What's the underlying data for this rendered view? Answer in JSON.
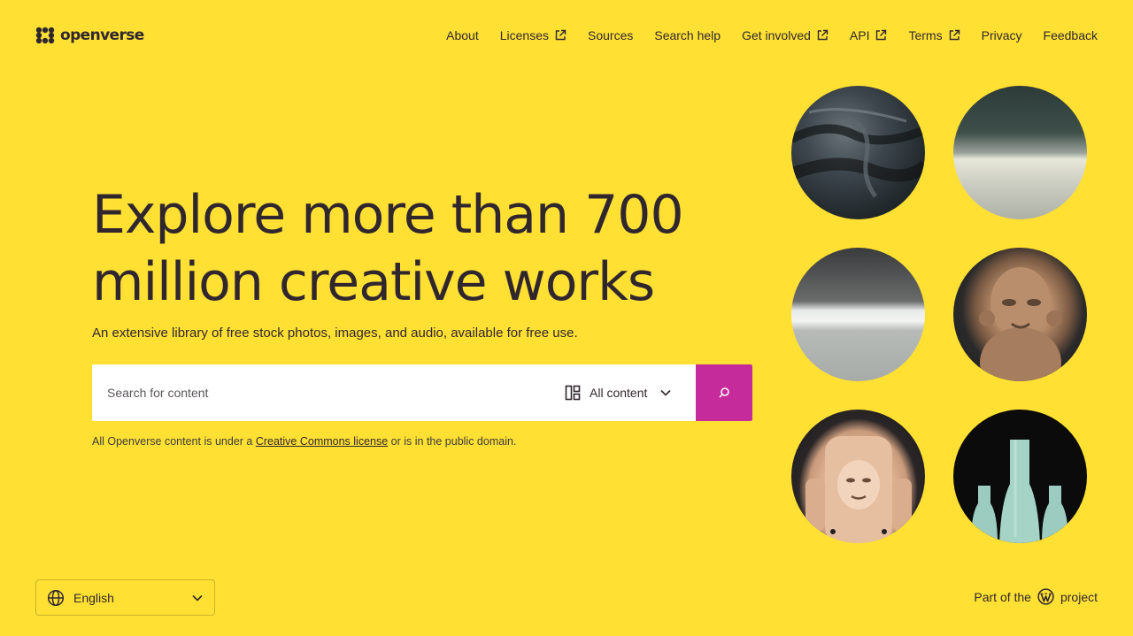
{
  "header": {
    "logo_text": "openverse",
    "nav": [
      {
        "label": "About",
        "external": false
      },
      {
        "label": "Licenses",
        "external": true
      },
      {
        "label": "Sources",
        "external": false
      },
      {
        "label": "Search help",
        "external": false
      },
      {
        "label": "Get involved",
        "external": true
      },
      {
        "label": "API",
        "external": true
      },
      {
        "label": "Terms",
        "external": true
      },
      {
        "label": "Privacy",
        "external": false
      },
      {
        "label": "Feedback",
        "external": false
      }
    ]
  },
  "hero": {
    "title": "Explore more than 700\nmillion creative works",
    "subtitle": "An extensive library of free stock photos, images, and audio, available for free use."
  },
  "search": {
    "placeholder": "Search for content",
    "value": "",
    "content_type": "All content",
    "content_type_icon": "content-grid-icon",
    "button_icon": "search-icon"
  },
  "legal": {
    "prefix": "All Openverse content is under a ",
    "link": "Creative Commons license",
    "suffix": " or is in the public domain."
  },
  "featured_images": [
    {
      "icon": "featured-image"
    },
    {
      "icon": "featured-image"
    },
    {
      "icon": "featured-image"
    },
    {
      "icon": "featured-image"
    },
    {
      "icon": "featured-image"
    },
    {
      "icon": "featured-image"
    }
  ],
  "footer": {
    "language": "English",
    "language_icon": "globe-icon",
    "part_of_prefix": "Part of the",
    "part_of_suffix": "project",
    "wordpress_icon": "wordpress-icon"
  },
  "colors": {
    "background": "#FFE033",
    "text": "#30272E",
    "search_button": "#C52B9B"
  }
}
